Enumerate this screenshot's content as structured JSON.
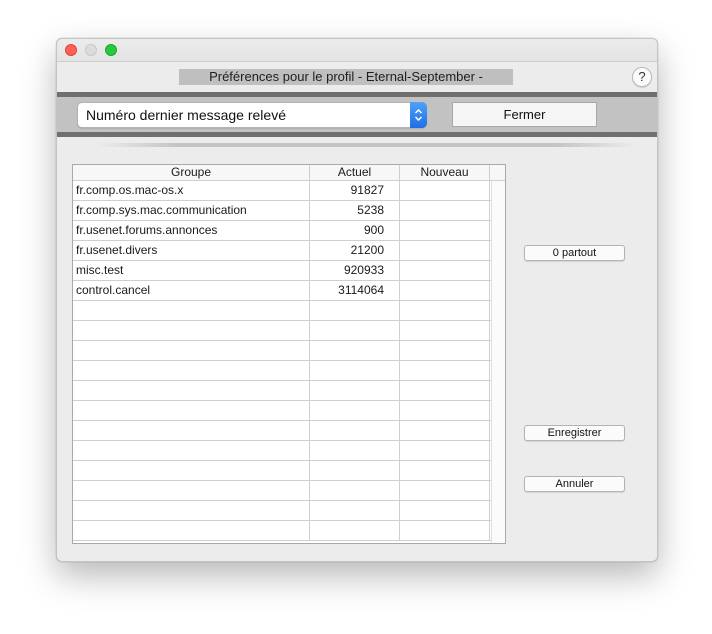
{
  "window": {
    "controls": [
      "close-icon",
      "minimize-icon",
      "zoom-icon"
    ]
  },
  "dialog": {
    "title": "Préférences pour le profil - Eternal-September -",
    "help_label": "?"
  },
  "toolbar": {
    "mode_select_value": "Numéro dernier message relevé",
    "close_button_label": "Fermer"
  },
  "table": {
    "headers": [
      "Groupe",
      "Actuel",
      "Nouveau"
    ],
    "rows": [
      {
        "group": "fr.comp.os.mac-os.x",
        "current": "91827",
        "new": ""
      },
      {
        "group": "fr.comp.sys.mac.communication",
        "current": "5238",
        "new": ""
      },
      {
        "group": "fr.usenet.forums.annonces",
        "current": "900",
        "new": ""
      },
      {
        "group": "fr.usenet.divers",
        "current": "21200",
        "new": ""
      },
      {
        "group": "misc.test",
        "current": "920933",
        "new": ""
      },
      {
        "group": "control.cancel",
        "current": "3114064",
        "new": ""
      }
    ],
    "empty_row_count": 12
  },
  "actions": {
    "zero_everywhere_label": "0 partout",
    "save_label": "Enregistrer",
    "cancel_label": "Annuler"
  },
  "colors": {
    "select_arrow_accent": "#1f6fe3",
    "close": "#fe5f57",
    "zoom": "#28c840"
  }
}
